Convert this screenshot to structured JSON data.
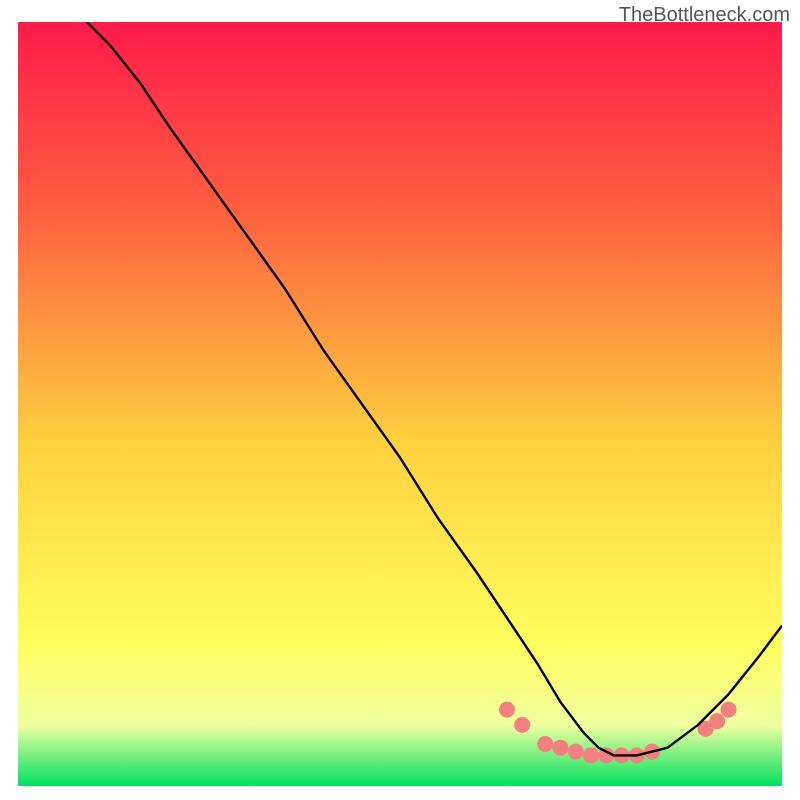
{
  "watermark": "TheBottleneck.com",
  "chart_data": {
    "type": "line",
    "title": "",
    "xlabel": "",
    "ylabel": "",
    "xlim": [
      0,
      100
    ],
    "ylim": [
      0,
      100
    ],
    "background_gradient": {
      "top": "#ff1a4a",
      "upper": "#ff6040",
      "mid": "#ffd040",
      "lower": "#ffff60",
      "bottom": "#00e060"
    },
    "curve": {
      "description": "Black performance-fit curve: descends steeply from top-left, bottoms out around x=76 near y=4, then rises toward the right edge.",
      "x": [
        9,
        12,
        16,
        20,
        25,
        30,
        35,
        40,
        45,
        50,
        55,
        60,
        64,
        68,
        71,
        74,
        76,
        78,
        81,
        85,
        89,
        93,
        97,
        100
      ],
      "y": [
        100,
        97,
        92,
        86,
        79,
        72,
        65,
        57,
        50,
        43,
        35,
        28,
        22,
        16,
        11,
        7,
        5,
        4,
        4,
        5,
        8,
        12,
        17,
        21
      ]
    },
    "markers": {
      "description": "Salmon markers clustered along the curve trough",
      "color": "#f28080",
      "points": [
        {
          "x": 64,
          "y": 10
        },
        {
          "x": 66,
          "y": 8
        },
        {
          "x": 69,
          "y": 5.5
        },
        {
          "x": 71,
          "y": 5
        },
        {
          "x": 73,
          "y": 4.5
        },
        {
          "x": 75,
          "y": 4
        },
        {
          "x": 77,
          "y": 4
        },
        {
          "x": 79,
          "y": 4
        },
        {
          "x": 81,
          "y": 4
        },
        {
          "x": 83,
          "y": 4.5
        },
        {
          "x": 90,
          "y": 7.5
        },
        {
          "x": 91.5,
          "y": 8.5
        },
        {
          "x": 93,
          "y": 10
        }
      ]
    }
  }
}
